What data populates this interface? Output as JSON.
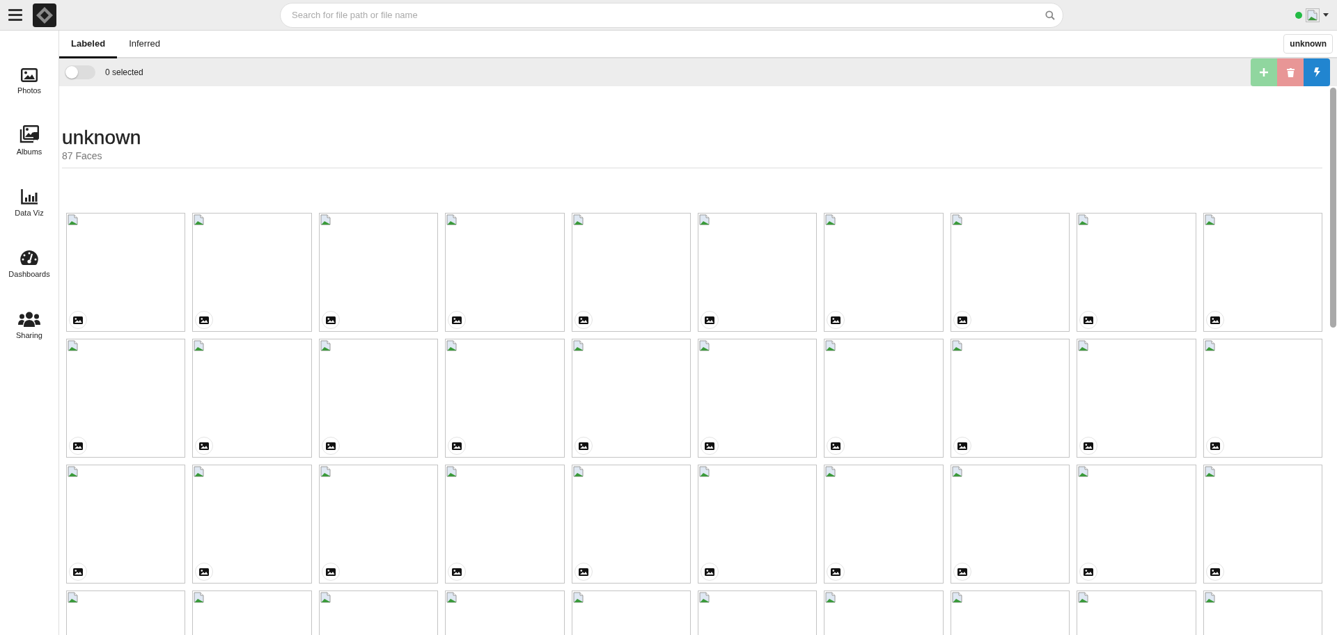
{
  "topbar": {
    "search": {
      "placeholder": "Search for file path or file name"
    },
    "status": {
      "online": true
    }
  },
  "sidebar": {
    "items": [
      {
        "label": "Photos",
        "kind": "photos"
      },
      {
        "label": "Albums",
        "kind": "albums"
      },
      {
        "label": "Data Viz",
        "kind": "dataviz"
      },
      {
        "label": "Dashboards",
        "kind": "dashboards"
      },
      {
        "label": "Sharing",
        "kind": "sharing"
      }
    ]
  },
  "tabs": [
    {
      "label": "Labeled",
      "selected": true
    },
    {
      "label": "Inferred",
      "selected": false
    }
  ],
  "person_button": {
    "label": "unknown"
  },
  "toolbar": {
    "select_toggle": {
      "on": false
    },
    "selected_count": "0 selected",
    "actions": [
      {
        "kind": "add",
        "disabled": true
      },
      {
        "kind": "delete",
        "disabled": true
      },
      {
        "kind": "train",
        "disabled": false
      }
    ]
  },
  "person": {
    "name": "unknown",
    "count": "87 Faces"
  },
  "faces": [
    {
      "kind": "face"
    },
    {
      "kind": "face"
    },
    {
      "kind": "face"
    },
    {
      "kind": "face"
    },
    {
      "kind": "face"
    },
    {
      "kind": "face"
    },
    {
      "kind": "face"
    },
    {
      "kind": "face"
    },
    {
      "kind": "face"
    },
    {
      "kind": "face"
    },
    {
      "kind": "face"
    },
    {
      "kind": "face"
    },
    {
      "kind": "face"
    },
    {
      "kind": "face"
    },
    {
      "kind": "face"
    },
    {
      "kind": "face"
    },
    {
      "kind": "face"
    },
    {
      "kind": "face"
    },
    {
      "kind": "face"
    },
    {
      "kind": "face"
    },
    {
      "kind": "face"
    },
    {
      "kind": "face"
    },
    {
      "kind": "face"
    },
    {
      "kind": "face"
    },
    {
      "kind": "face"
    },
    {
      "kind": "face"
    },
    {
      "kind": "face"
    },
    {
      "kind": "face"
    },
    {
      "kind": "face"
    },
    {
      "kind": "face"
    },
    {
      "kind": "face_cut"
    },
    {
      "kind": "face_cut"
    },
    {
      "kind": "face_cut"
    },
    {
      "kind": "face_cut"
    },
    {
      "kind": "face_cut"
    },
    {
      "kind": "face_cut"
    },
    {
      "kind": "face_cut"
    },
    {
      "kind": "face_cut"
    },
    {
      "kind": "face_cut"
    },
    {
      "kind": "face_cut"
    }
  ]
}
